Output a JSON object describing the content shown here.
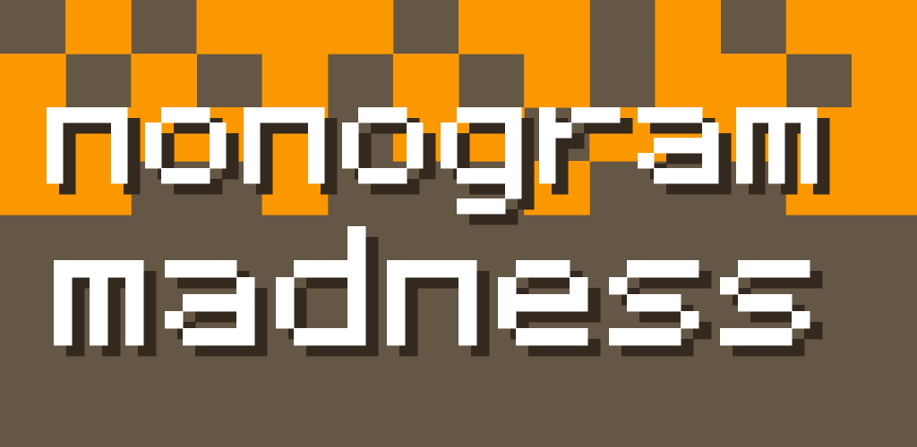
{
  "title": {
    "line1": "nonogram",
    "line2": "madness"
  },
  "colors": {
    "background": "#645745",
    "tile": "#fb9800",
    "letter": "#ffffff",
    "shadow": "#33291e"
  },
  "board": {
    "columns": 14,
    "rows": 4,
    "filled_cells": [
      [
        1,
        0
      ],
      [
        3,
        0
      ],
      [
        4,
        0
      ],
      [
        5,
        0
      ],
      [
        7,
        0
      ],
      [
        8,
        0
      ],
      [
        10,
        0
      ],
      [
        12,
        0
      ],
      [
        13,
        0
      ],
      [
        0,
        1
      ],
      [
        2,
        1
      ],
      [
        4,
        1
      ],
      [
        6,
        1
      ],
      [
        8,
        1
      ],
      [
        10,
        1
      ],
      [
        11,
        1
      ],
      [
        13,
        1
      ],
      [
        0,
        2
      ],
      [
        1,
        2
      ],
      [
        2,
        2
      ],
      [
        3,
        2
      ],
      [
        4,
        2
      ],
      [
        6,
        2
      ],
      [
        7,
        2
      ],
      [
        9,
        2
      ],
      [
        10,
        2
      ],
      [
        11,
        2
      ],
      [
        12,
        2
      ],
      [
        13,
        2
      ],
      [
        0,
        3
      ],
      [
        1,
        3
      ],
      [
        4,
        3
      ],
      [
        8,
        3
      ],
      [
        12,
        3
      ],
      [
        13,
        3
      ]
    ]
  }
}
